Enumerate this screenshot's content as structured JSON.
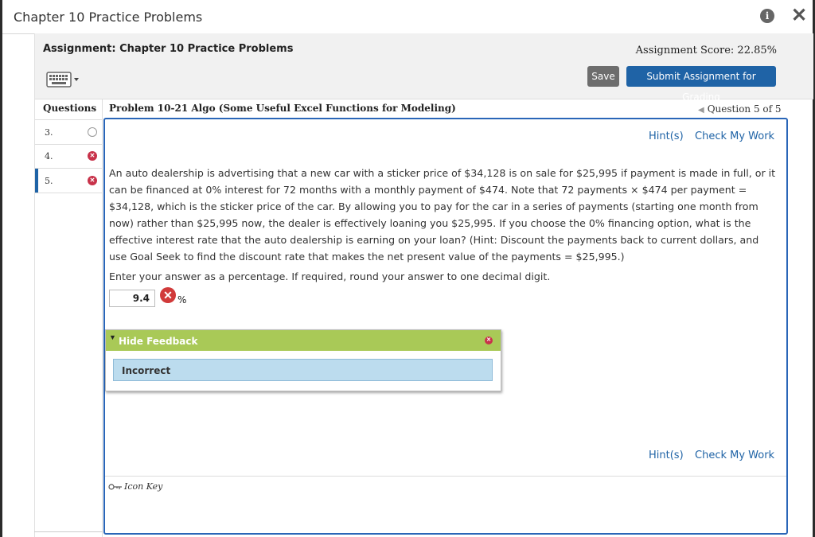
{
  "window": {
    "title": "Chapter 10 Practice Problems",
    "info_icon": "info-icon",
    "close_icon": "close-icon",
    "close_glyph": "✕"
  },
  "header": {
    "assignment_title": "Assignment: Chapter 10 Practice Problems",
    "score": "Assignment Score: 22.85%",
    "keyboard_icon": "keyboard-icon",
    "save_label": "Save",
    "submit_label": "Submit Assignment for Grading"
  },
  "sidebar": {
    "header": "Questions",
    "items": [
      {
        "number": "3.",
        "status": "not-attempted"
      },
      {
        "number": "4.",
        "status": "incorrect"
      },
      {
        "number": "5.",
        "status": "incorrect",
        "active": true
      }
    ]
  },
  "problem": {
    "title": "Problem 10-21 Algo (Some Useful Excel Functions for Modeling)",
    "nav": "Question 5 of 5",
    "hint_label": "Hint(s)",
    "check_label": "Check My Work",
    "text": "An auto dealership is advertising that a new car with a sticker price of $34,128 is on sale for $25,995 if payment is made in full, or it can be financed at 0% interest for 72 months with a monthly payment of $474. Note that 72 payments × $474 per payment = $34,128, which is the sticker price of the car. By allowing you to pay for the car in a series of payments (starting one month from now) rather than $25,995 now, the dealer is effectively loaning you $25,995. If you choose the 0% financing option, what is the effective interest rate that the auto dealership is earning on your loan? (Hint: Discount the payments back to current dollars, and use Goal Seek to find the discount rate that makes the net present value of the payments = $25,995.)",
    "instruction": "Enter your answer as a percentage. If required, round your answer to one decimal digit.",
    "answer_value": "9.4",
    "unit": "%"
  },
  "feedback": {
    "toggle_label": "Hide Feedback",
    "result": "Incorrect"
  },
  "footer": {
    "icon_key_label": "Icon Key"
  },
  "colors": {
    "primary": "#1f63a6",
    "feedback_header": "#a9c957",
    "feedback_result": "#bcdcee",
    "incorrect": "#c8324a"
  }
}
